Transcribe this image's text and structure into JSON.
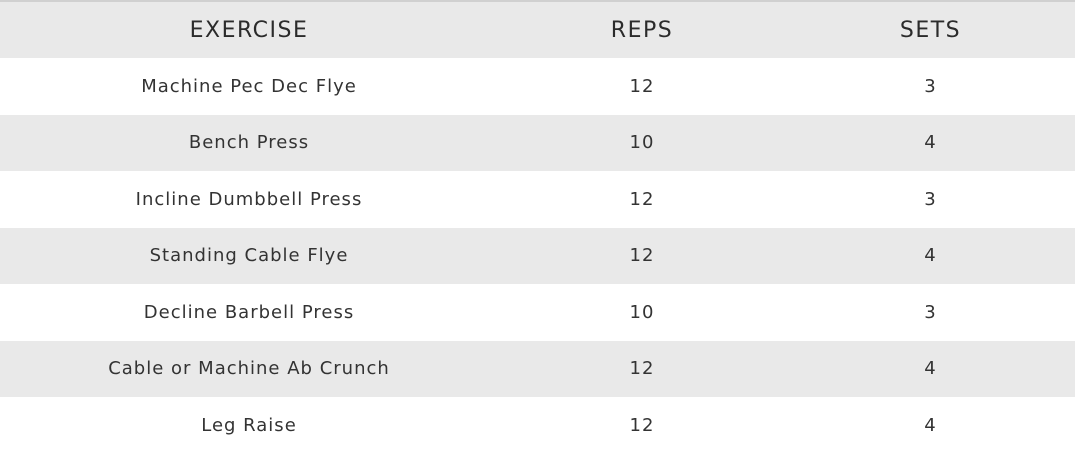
{
  "table": {
    "headers": {
      "exercise": "EXERCISE",
      "reps": "REPS",
      "sets": "SETS"
    },
    "rows": [
      {
        "exercise": "Machine Pec Dec Flye",
        "reps": "12",
        "sets": "3"
      },
      {
        "exercise": "Bench Press",
        "reps": "10",
        "sets": "4"
      },
      {
        "exercise": "Incline Dumbbell Press",
        "reps": "12",
        "sets": "3"
      },
      {
        "exercise": "Standing Cable Flye",
        "reps": "12",
        "sets": "4"
      },
      {
        "exercise": "Decline Barbell Press",
        "reps": "10",
        "sets": "3"
      },
      {
        "exercise": "Cable or Machine Ab Crunch",
        "reps": "12",
        "sets": "4"
      },
      {
        "exercise": "Leg Raise",
        "reps": "12",
        "sets": "4"
      }
    ]
  },
  "colors": {
    "shaded_row": "#e9e9e9",
    "plain_row": "#ffffff",
    "text": "#333333"
  }
}
